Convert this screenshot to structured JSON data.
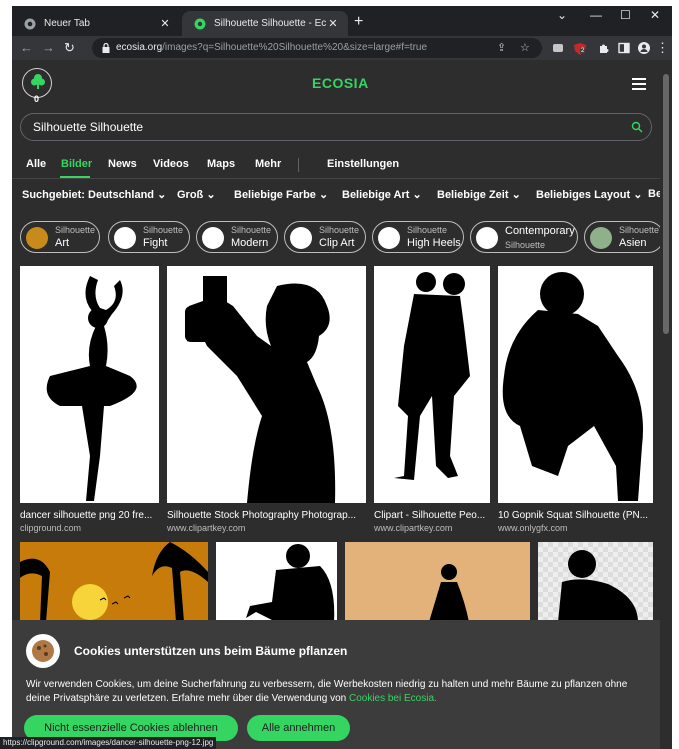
{
  "browser": {
    "tabs": [
      {
        "title": "Neuer Tab",
        "active": false
      },
      {
        "title": "Silhouette Silhouette - Ecosia - Ir",
        "active": true
      }
    ],
    "url_host": "ecosia.org",
    "url_path": "/images?q=Silhouette%20Silhouette%20&size=large#f=true",
    "ext_badge": "2",
    "status_url": "https://clipground.com/images/dancer-silhouette-png-12.jpg"
  },
  "header": {
    "tree_count": "0",
    "logo": "ECOSIA"
  },
  "search": {
    "query": "Silhouette Silhouette"
  },
  "nav": {
    "tabs": [
      "Alle",
      "Bilder",
      "News",
      "Videos",
      "Maps",
      "Mehr"
    ],
    "settings": "Einstellungen"
  },
  "filters": [
    "Suchgebiet: Deutschland",
    "Groß",
    "Beliebige Farbe",
    "Beliebige Art",
    "Beliebige Zeit",
    "Beliebiges Layout",
    "Be"
  ],
  "chips": [
    {
      "l1": "Silhouette",
      "l2": "Art"
    },
    {
      "l1": "Silhouette",
      "l2": "Fight"
    },
    {
      "l1": "Silhouette",
      "l2": "Modern"
    },
    {
      "l1": "Silhouette",
      "l2": "Clip Art"
    },
    {
      "l1": "Silhouette",
      "l2": "High Heels"
    },
    {
      "l1": "Contemporary",
      "l2": "Silhouette"
    },
    {
      "l1": "Silhouette",
      "l2": "Asien"
    }
  ],
  "results": [
    {
      "caption": "dancer silhouette png 20 fre...",
      "domain": "clipground.com"
    },
    {
      "caption": "Silhouette Stock Photography Photograp...",
      "domain": "www.clipartkey.com"
    },
    {
      "caption": "Clipart - Silhouette Peo...",
      "domain": "www.clipartkey.com"
    },
    {
      "caption": "10 Gopnik Squat Silhouette (PN...",
      "domain": "www.onlygfx.com"
    }
  ],
  "cookie": {
    "title": "Cookies unterstützen uns beim Bäume pflanzen",
    "text": "Wir verwenden Cookies, um deine Sucherfahrung zu verbessern, die Werbekosten niedrig zu halten und mehr Bäume zu pflanzen ohne deine Privatsphäre zu verletzen. Erfahre mehr über die Verwendung von",
    "link": "Cookies bei Ecosia.",
    "decline": "Nicht essenzielle Cookies ablehnen",
    "accept": "Alle annehmen"
  },
  "colors": {
    "accent": "#35d562",
    "background": "#2d2d2d"
  }
}
